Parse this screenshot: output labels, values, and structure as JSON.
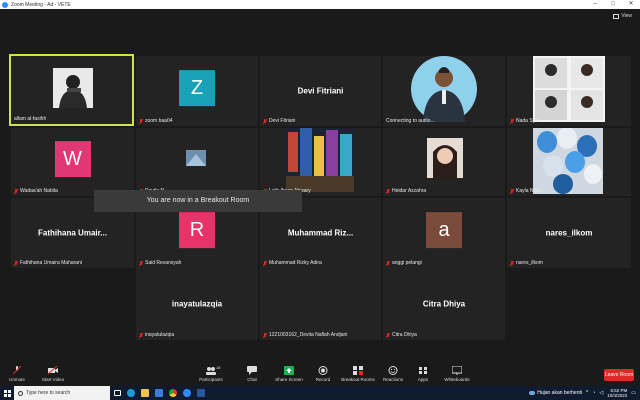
{
  "window": {
    "title": "Zoom Meeting - Ad - VETE",
    "min": "–",
    "max": "□",
    "close": "✕"
  },
  "view": {
    "label": "View"
  },
  "tiles": [
    {
      "name": "allam al-fasihh"
    },
    {
      "name": "zoom baa04",
      "letter": "Z",
      "color": "#17a2b8"
    },
    {
      "name": "Devi Fitriani",
      "big": "Devi Fitriani"
    },
    {
      "name": "Connecting to audio..."
    },
    {
      "name": "Nada Syifa"
    },
    {
      "name": "Wadaa'ah Nabila",
      "letter": "W",
      "color": "#e03874"
    },
    {
      "name": "Devita N"
    },
    {
      "name": "Laily Ihsan Ahwary"
    },
    {
      "name": "Heidar Azzahra"
    },
    {
      "name": "Kayla Nailur"
    },
    {
      "name": "Fathihana Umaira Maharani",
      "big": "Fathihana  Umair..."
    },
    {
      "name": "Said Revansyah",
      "letter": "R",
      "color": "#e8336a"
    },
    {
      "name": "Muhammad Rizky Adira",
      "big": "Muhammad  Riz..."
    },
    {
      "name": "anggi pelangi",
      "letter": "a",
      "color": "#7a4a3a"
    },
    {
      "name": "nares_ilkom",
      "big": "nares_ilkom"
    },
    {
      "name": "inayatulazqia",
      "big": "inayatulazqia"
    },
    {
      "name": "1221003162_Devita Naflah Andjani"
    },
    {
      "name": "Citra Dhiya",
      "big": "Citra Dhiya"
    }
  ],
  "toast": "You are now in a Breakout Room",
  "toolbar": {
    "unmute": "Unmute",
    "start_video": "Start Video",
    "participants": "Participants",
    "participants_count": "18",
    "chat": "Chat",
    "share_screen": "Share Screen",
    "record": "Record",
    "breakout_rooms": "Breakout Rooms",
    "reactions": "Reactions",
    "apps": "Apps",
    "whiteboards": "Whiteboards",
    "leave": "Leave Room"
  },
  "taskbar": {
    "search_placeholder": "Type here to search",
    "weather": "Hujan akan berhenti",
    "time": "6:52 PM",
    "date": "10/4/2022"
  },
  "colors": {
    "active_border": "#cfe34a",
    "leave": "#e02828",
    "accent": "#2d8cff"
  }
}
